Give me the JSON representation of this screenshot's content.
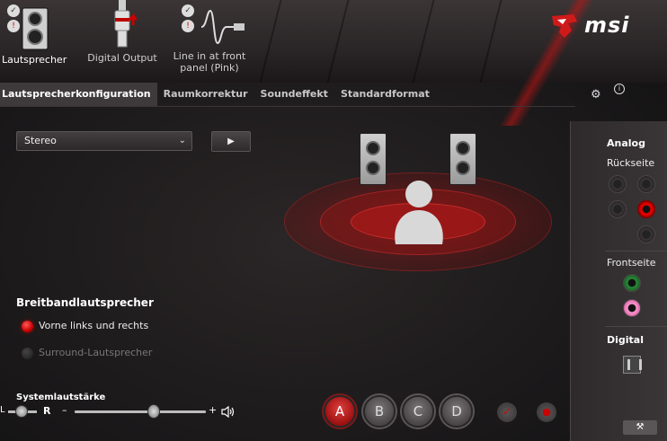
{
  "devices": [
    {
      "label": "Lautsprecher",
      "active": true
    },
    {
      "label": "Digital Output",
      "active": false
    },
    {
      "label": "Line in at front panel (Pink)",
      "active": false
    }
  ],
  "brand": {
    "logo_text": "msi",
    "accent": "#d01a1a"
  },
  "tabs": [
    {
      "label": "Lautsprecherkonfiguration",
      "active": true
    },
    {
      "label": "Raumkorrektur",
      "active": false
    },
    {
      "label": "Soundeffekt",
      "active": false
    },
    {
      "label": "Standardformat",
      "active": false
    }
  ],
  "config": {
    "selected": "Stereo",
    "play_icon": "play-icon"
  },
  "broadband": {
    "title": "Breitbandlautsprecher",
    "options": [
      {
        "label": "Vorne links und rechts",
        "checked": true
      },
      {
        "label": "Surround-Lautsprecher",
        "checked": false
      }
    ]
  },
  "volume": {
    "title": "Systemlautstärke",
    "left_label": "L",
    "right_label": "R",
    "minus": "–",
    "plus": "+",
    "level": 0.6
  },
  "profiles": [
    "A",
    "B",
    "C",
    "D"
  ],
  "active_profile": "A",
  "panel": {
    "analog_title": "Analog",
    "rear_label": "Rückseite",
    "front_label": "Frontseite",
    "digital_title": "Digital"
  }
}
